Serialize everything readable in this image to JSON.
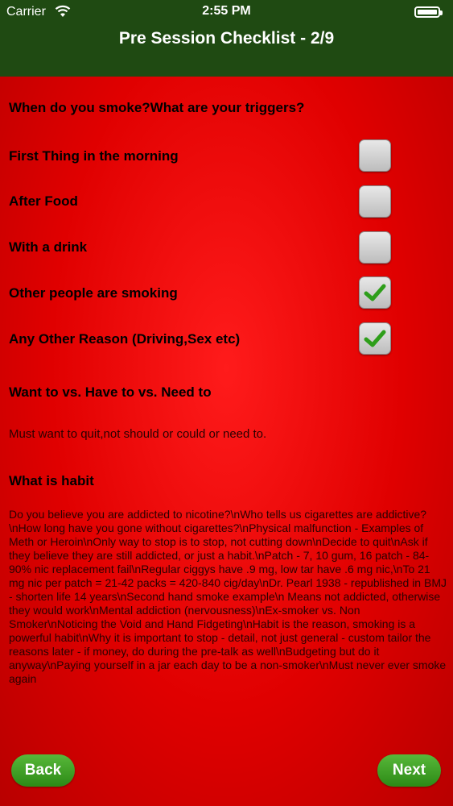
{
  "status_bar": {
    "carrier": "Carrier",
    "time": "2:55 PM"
  },
  "header": {
    "title": "Pre Session Checklist - 2/9"
  },
  "question": "When do you smoke?What are your triggers?",
  "options": [
    {
      "label": "First Thing in the morning",
      "checked": false
    },
    {
      "label": "After Food",
      "checked": false
    },
    {
      "label": "With a drink",
      "checked": false
    },
    {
      "label": "Other people are smoking",
      "checked": true
    },
    {
      "label": "Any Other Reason (Driving,Sex etc)",
      "checked": true
    }
  ],
  "want_section": {
    "heading": "Want to vs. Have to vs. Need to",
    "text": "Must want to quit,not should or could or need to."
  },
  "habit_section": {
    "heading": "What is habit",
    "text": "Do you believe you are addicted to nicotine?\\nWho tells us cigarettes are addictive?\\nHow long have you gone without cigarettes?\\nPhysical malfunction - Examples of Meth or Heroin\\nOnly way to stop is to stop, not cutting down\\nDecide to quit\\nAsk if they believe they are still addicted, or just a habit.\\nPatch - 7, 10 gum, 16 patch - 84-90% nic replacement fail\\nRegular ciggys have .9 mg, low tar have .6 mg nic,\\nTo 21 mg nic per patch = 21-42 packs = 420-840 cig/day\\nDr. Pearl 1938 - republished in BMJ - shorten life 14 years\\nSecond hand smoke example\\n        Means not addicted, otherwise they would work\\nMental addiction (nervousness)\\nEx-smoker vs. Non Smoker\\nNoticing the Void and Hand Fidgeting\\nHabit is the reason, smoking is a powerful habit\\nWhy it is important to stop - detail, not just general - custom tailor the reasons later - if money, do during the pre-talk as well\\nBudgeting but do it anyway\\nPaying yourself in a jar each day to be a non-smoker\\nMust never ever smoke again"
  },
  "buttons": {
    "back": "Back",
    "next": "Next"
  },
  "colors": {
    "header_bg": "#1f4a12",
    "content_bg": "#e00000",
    "button_green": "#3a9a22",
    "check_green": "#2e9e1a"
  }
}
